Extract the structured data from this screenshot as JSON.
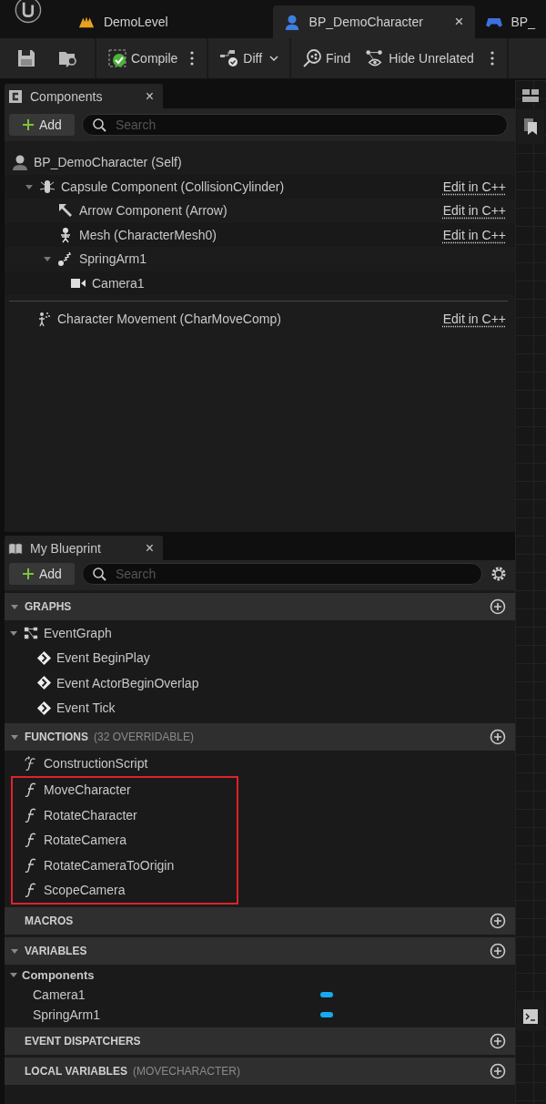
{
  "doc_tabs": [
    {
      "label": "DemoLevel",
      "selected": false,
      "kind": "level"
    },
    {
      "label": "BP_DemoCharacter",
      "selected": true,
      "kind": "blueprint",
      "close": "×"
    },
    {
      "label": "BP_",
      "selected": false,
      "kind": "gamepad"
    }
  ],
  "toolbar": {
    "compile": "Compile",
    "diff": "Diff",
    "find": "Find",
    "hide_unrelated": "Hide Unrelated"
  },
  "components": {
    "title": "Components",
    "close": "×",
    "add": "Add",
    "search_placeholder": "Search",
    "tree": [
      {
        "label": "BP_DemoCharacter (Self)",
        "children": [
          {
            "label": "Capsule Component (CollisionCylinder)",
            "edit_link": "Edit in C++",
            "expanded": true,
            "children": [
              {
                "label": "Arrow Component (Arrow)",
                "edit_link": "Edit in C++"
              },
              {
                "label": "Mesh (CharacterMesh0)",
                "edit_link": "Edit in C++"
              },
              {
                "label": "SpringArm1",
                "expanded": true,
                "children": [
                  {
                    "label": "Camera1"
                  }
                ]
              }
            ]
          }
        ]
      }
    ],
    "other": [
      {
        "label": "Character Movement (CharMoveComp)",
        "edit_link": "Edit in C++"
      }
    ]
  },
  "my_blueprint": {
    "title": "My Blueprint",
    "close": "×",
    "add": "Add",
    "search_placeholder": "Search",
    "sections": [
      {
        "title": "GRAPHS",
        "expanded": true,
        "items": [
          {
            "label": "EventGraph",
            "kind": "graph",
            "expanded": true,
            "children": [
              {
                "label": "Event BeginPlay",
                "kind": "event"
              },
              {
                "label": "Event ActorBeginOverlap",
                "kind": "event"
              },
              {
                "label": "Event Tick",
                "kind": "event"
              }
            ]
          }
        ]
      },
      {
        "title": "FUNCTIONS",
        "subtitle": "(32 OVERRIDABLE)",
        "expanded": true,
        "items": [
          {
            "label": "ConstructionScript",
            "kind": "construction",
            "highlighted": false
          },
          {
            "label": "MoveCharacter",
            "kind": "function",
            "highlighted": true
          },
          {
            "label": "RotateCharacter",
            "kind": "function",
            "highlighted": true
          },
          {
            "label": "RotateCamera",
            "kind": "function",
            "highlighted": true
          },
          {
            "label": "RotateCameraToOrigin",
            "kind": "function",
            "highlighted": true
          },
          {
            "label": "ScopeCamera",
            "kind": "function",
            "highlighted": true
          }
        ]
      },
      {
        "title": "MACROS"
      },
      {
        "title": "VARIABLES",
        "expanded": true,
        "items": [
          {
            "label": "Components",
            "kind": "category",
            "expanded": true,
            "children": [
              {
                "label": "Camera1",
                "kind": "variable"
              },
              {
                "label": "SpringArm1",
                "kind": "variable"
              }
            ]
          }
        ]
      },
      {
        "title": "EVENT DISPATCHERS"
      },
      {
        "title": "LOCAL VARIABLES",
        "subtitle": "(MOVECHARACTER)"
      }
    ]
  }
}
